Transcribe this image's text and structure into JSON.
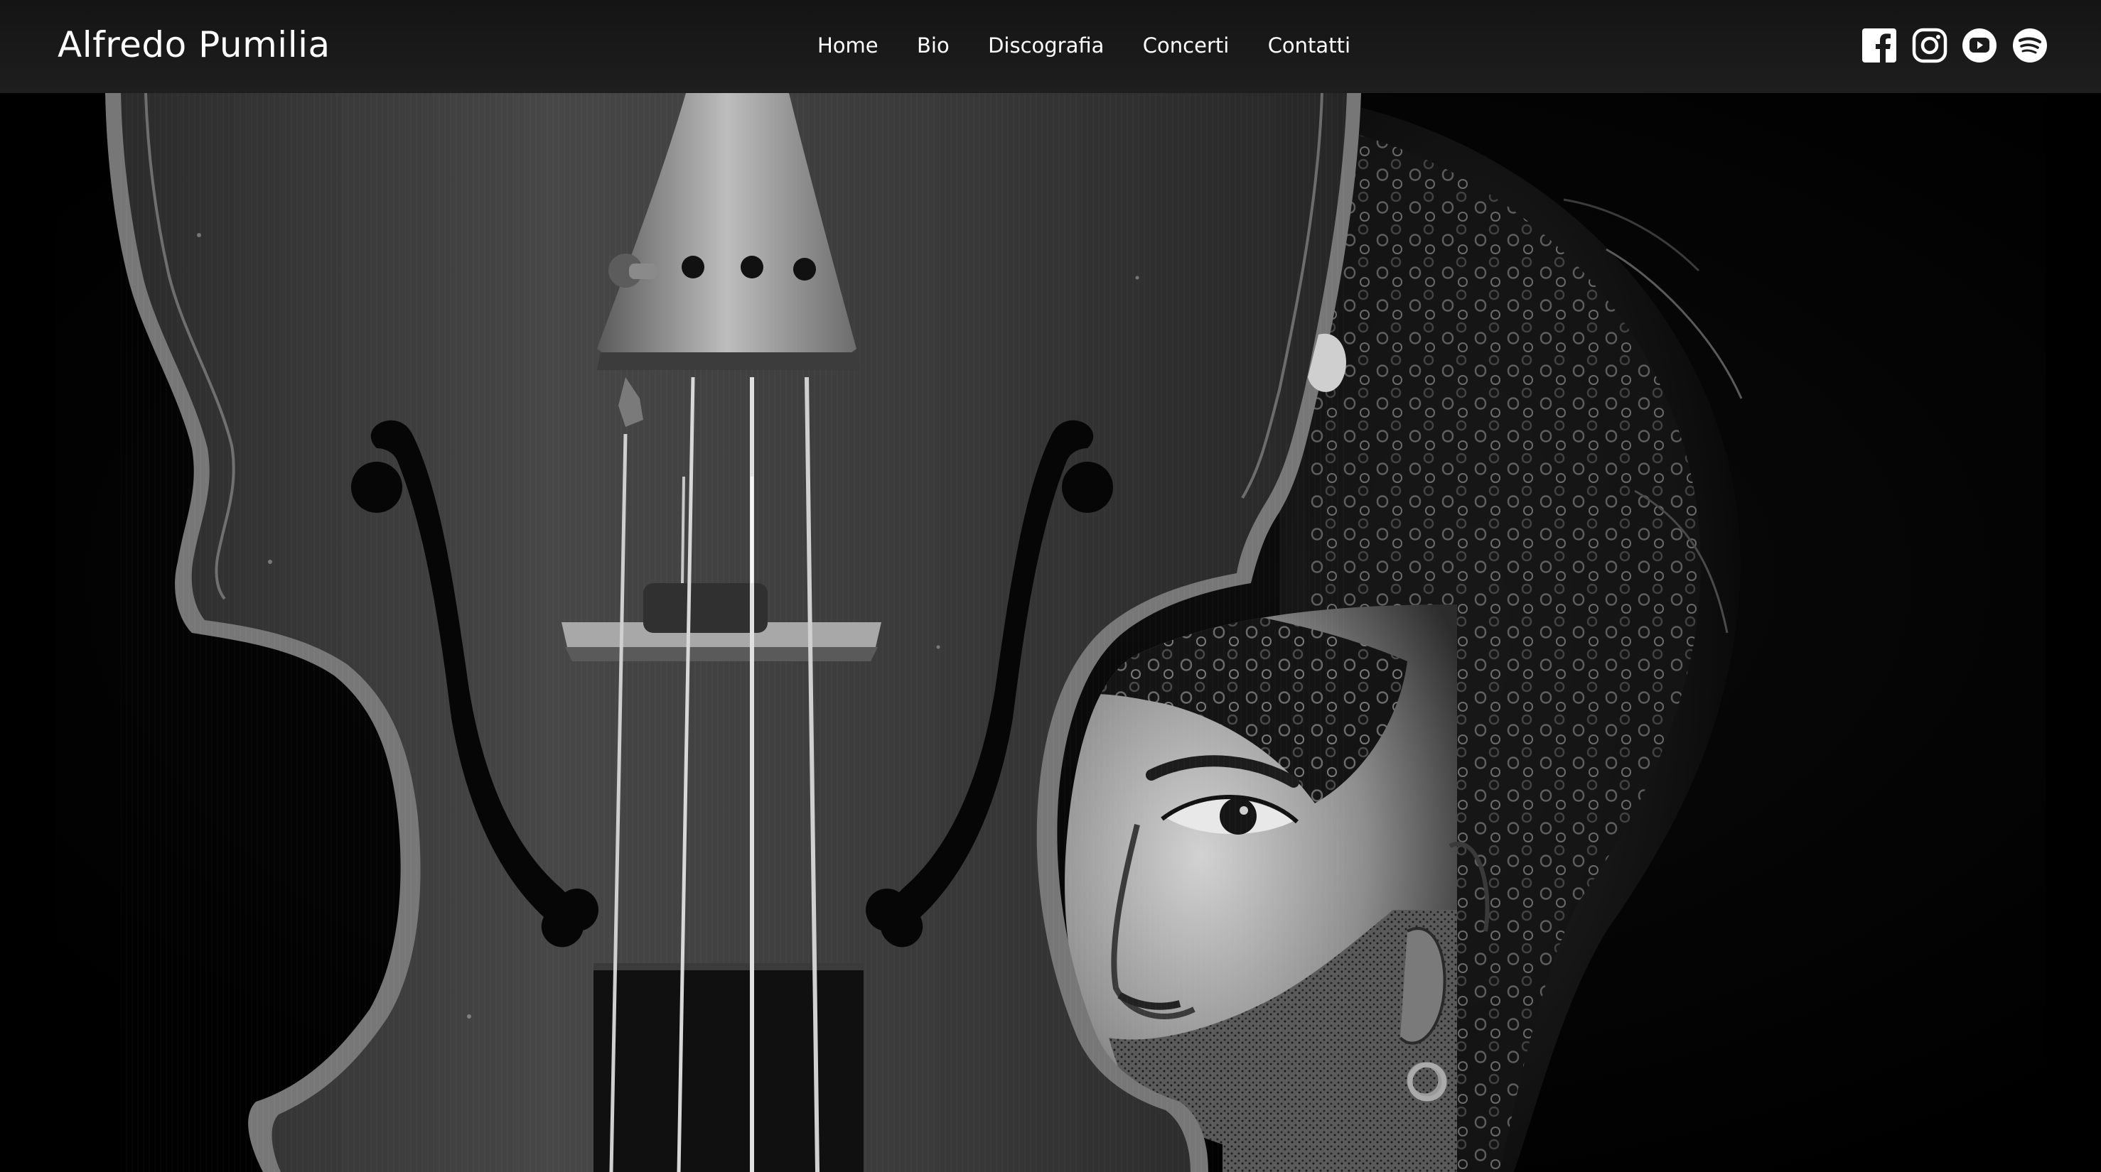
{
  "header": {
    "brand": "Alfredo Pumilia",
    "nav": [
      {
        "label": "Home"
      },
      {
        "label": "Bio"
      },
      {
        "label": "Discografia"
      },
      {
        "label": "Concerti"
      },
      {
        "label": "Contatti"
      }
    ],
    "socials": [
      {
        "icon": "facebook-icon"
      },
      {
        "icon": "instagram-icon"
      },
      {
        "icon": "youtube-icon"
      },
      {
        "icon": "spotify-icon"
      }
    ]
  },
  "hero": {
    "image": "black-and-white portrait: violin body with a man's curly-haired face showing through the violin's waist",
    "palette": {
      "background": "#000000",
      "text": "#ffffff",
      "header": "#1a1a1a"
    }
  }
}
